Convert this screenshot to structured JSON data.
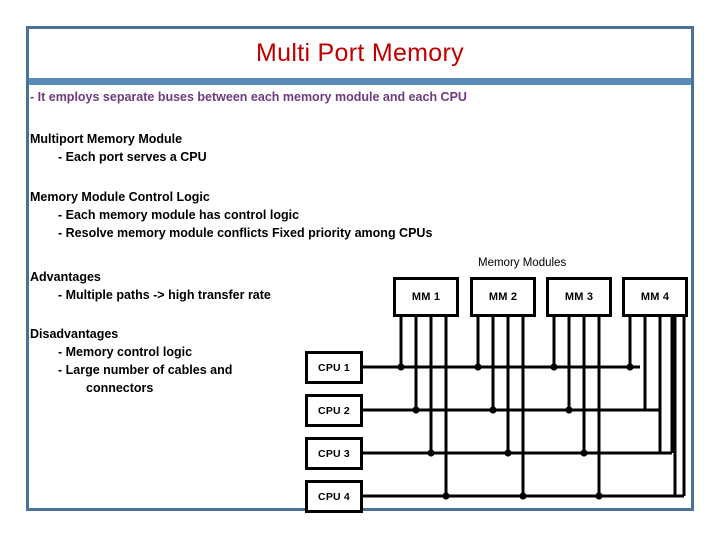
{
  "slide": {
    "title": "Multi Port Memory",
    "accent_border": "#4a7299",
    "title_color": "#c00000",
    "rule_color": "#5b8cb8",
    "lead_color": "#6f3a80",
    "lead": "- It employs separate buses between each memory module and each CPU"
  },
  "sections": [
    {
      "heading": "Multiport Memory Module",
      "bullets": [
        "- Each port serves a CPU"
      ]
    },
    {
      "heading": "Memory Module Control Logic",
      "bullets": [
        "- Each memory module has control logic",
        "- Resolve memory module conflicts Fixed priority among CPUs"
      ]
    },
    {
      "heading": "Advantages",
      "bullets": [
        "- Multiple paths -> high transfer rate"
      ]
    },
    {
      "heading": "Disadvantages",
      "bullets": [
        "- Memory control logic",
        "- Large number of cables and"
      ],
      "bullets_cont": "connectors"
    }
  ],
  "diagram": {
    "memory_modules_label": "Memory Modules",
    "memory_modules": [
      "MM 1",
      "MM 2",
      "MM 3",
      "MM 4"
    ],
    "cpus": [
      "CPU 1",
      "CPU 2",
      "CPU 3",
      "CPU 4"
    ],
    "line_color": "#000000"
  }
}
